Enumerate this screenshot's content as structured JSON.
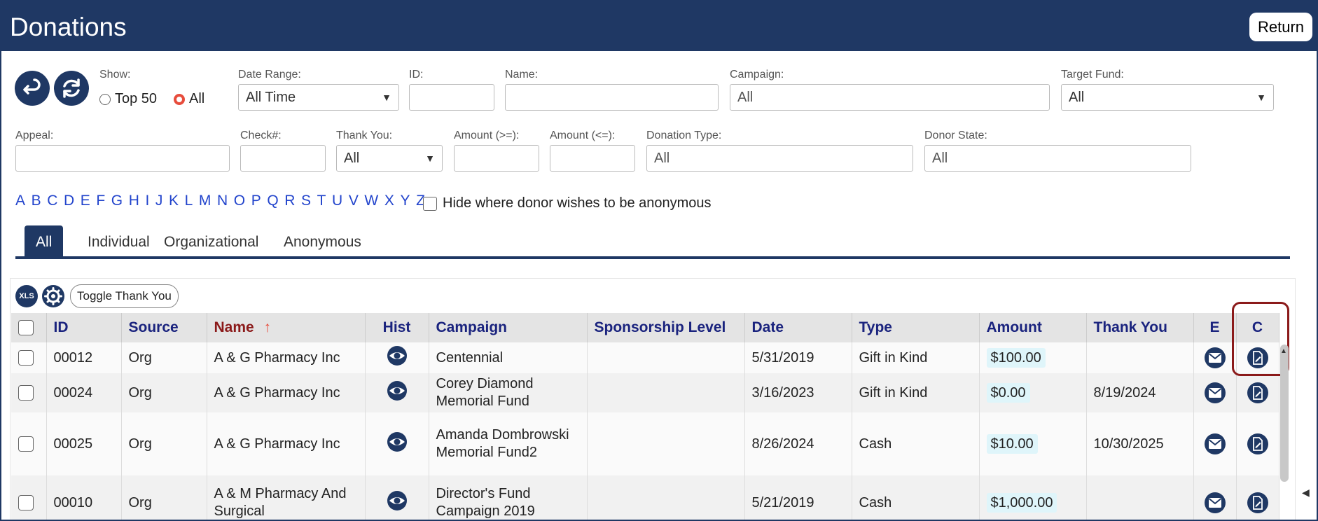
{
  "header": {
    "title": "Donations",
    "return_label": "Return"
  },
  "filters": {
    "show_label": "Show:",
    "show_options": [
      "Top 50",
      "All"
    ],
    "date_range_label": "Date Range:",
    "date_range_value": "All Time",
    "id_label": "ID:",
    "name_label": "Name:",
    "campaign_label": "Campaign:",
    "campaign_value": "All",
    "target_fund_label": "Target Fund:",
    "target_fund_value": "All",
    "appeal_label": "Appeal:",
    "check_label": "Check#:",
    "thank_you_label": "Thank You:",
    "thank_you_value": "All",
    "amount_ge_label": "Amount (>=):",
    "amount_le_label": "Amount (<=):",
    "donation_type_label": "Donation Type:",
    "donation_type_value": "All",
    "donor_state_label": "Donor State:",
    "donor_state_value": "All"
  },
  "alphabet": [
    "A",
    "B",
    "C",
    "D",
    "E",
    "F",
    "G",
    "H",
    "I",
    "J",
    "K",
    "L",
    "M",
    "N",
    "O",
    "P",
    "Q",
    "R",
    "S",
    "T",
    "U",
    "V",
    "W",
    "X",
    "Y",
    "Z"
  ],
  "anonymous_checkbox_label": "Hide where donor wishes to be anonymous",
  "tabs": [
    "All",
    "Individual",
    "Organizational",
    "Anonymous"
  ],
  "toolbar": {
    "xls_label": "XLS",
    "toggle_thank_you_label": "Toggle Thank You"
  },
  "table": {
    "columns": [
      "ID",
      "Source",
      "Name",
      "Hist",
      "Campaign",
      "Sponsorship Level",
      "Date",
      "Type",
      "Amount",
      "Thank You",
      "E",
      "C"
    ],
    "sort_arrow": "↑",
    "rows": [
      {
        "id": "00012",
        "source": "Org",
        "name": "A & G Pharmacy Inc",
        "campaign": "Centennial",
        "sponsorship": "",
        "date": "5/31/2019",
        "type": "Gift in Kind",
        "amount": "$100.00",
        "thank_you": ""
      },
      {
        "id": "00024",
        "source": "Org",
        "name": "A & G Pharmacy Inc",
        "campaign": "Corey Diamond Memorial Fund",
        "sponsorship": "",
        "date": "3/16/2023",
        "type": "Gift in Kind",
        "amount": "$0.00",
        "thank_you": "8/19/2024"
      },
      {
        "id": "00025",
        "source": "Org",
        "name": "A & G Pharmacy Inc",
        "campaign": "Amanda Dombrowski Memorial Fund2",
        "sponsorship": "",
        "date": "8/26/2024",
        "type": "Cash",
        "amount": "$10.00",
        "thank_you": "10/30/2025"
      },
      {
        "id": "00010",
        "source": "Org",
        "name": "A & M Pharmacy And Surgical",
        "campaign": "Director's Fund Campaign 2019",
        "sponsorship": "",
        "date": "5/21/2019",
        "type": "Cash",
        "amount": "$1,000.00",
        "thank_you": ""
      }
    ]
  },
  "colors": {
    "header_bg": "#1f3864",
    "highlight": "#8b1a1a",
    "link": "#2244cc"
  }
}
